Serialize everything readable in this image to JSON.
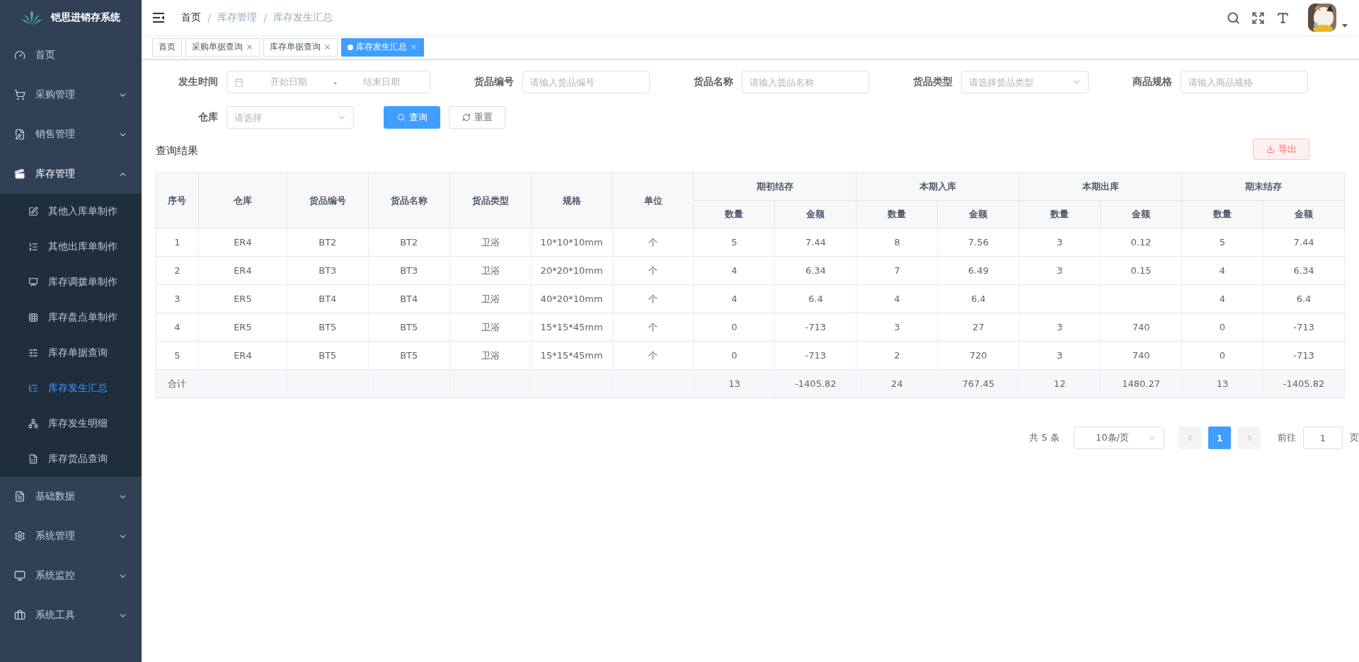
{
  "app": {
    "title": "铠思进销存系统"
  },
  "sidebar": {
    "items": [
      {
        "kind": "link",
        "label": "首页"
      },
      {
        "kind": "group",
        "label": "采购管理",
        "expanded": false
      },
      {
        "kind": "group",
        "label": "销售管理",
        "expanded": false
      },
      {
        "kind": "group",
        "label": "库存管理",
        "expanded": true,
        "children": [
          {
            "label": "其他入库单制作",
            "selected": false
          },
          {
            "label": "其他出库单制作",
            "selected": false
          },
          {
            "label": "库存调拨单制作",
            "selected": false
          },
          {
            "label": "库存盘点单制作",
            "selected": false
          },
          {
            "label": "库存单据查询",
            "selected": false
          },
          {
            "label": "库存发生汇总",
            "selected": true
          },
          {
            "label": "库存发生明细",
            "selected": false
          },
          {
            "label": "库存货品查询",
            "selected": false
          }
        ]
      },
      {
        "kind": "group",
        "label": "基础数据",
        "expanded": false
      },
      {
        "kind": "group",
        "label": "系统管理",
        "expanded": false
      },
      {
        "kind": "group",
        "label": "系统监控",
        "expanded": false
      },
      {
        "kind": "group",
        "label": "系统工具",
        "expanded": false
      }
    ]
  },
  "breadcrumb": {
    "items": [
      "首页",
      "库存管理",
      "库存发生汇总"
    ],
    "separator": "/"
  },
  "tags": [
    {
      "label": "首页",
      "selected": false,
      "closable": false
    },
    {
      "label": "采购单据查询",
      "selected": false,
      "closable": true
    },
    {
      "label": "库存单据查询",
      "selected": false,
      "closable": true
    },
    {
      "label": "库存发生汇总",
      "selected": true,
      "closable": true
    }
  ],
  "filters": [
    {
      "kind": "date-range",
      "label": "发生时间",
      "start_placeholder": "开始日期",
      "separator": "-",
      "end_placeholder": "结束日期"
    },
    {
      "kind": "input",
      "label": "货品编号",
      "placeholder": "请输入货品编号"
    },
    {
      "kind": "input",
      "label": "货品名称",
      "placeholder": "请输入货品名称"
    },
    {
      "kind": "select",
      "label": "货品类型",
      "placeholder": "请选择货品类型"
    },
    {
      "kind": "input",
      "label": "商品规格",
      "placeholder": "请输入商品规格"
    },
    {
      "kind": "select",
      "label": "仓库",
      "placeholder": "请选择"
    }
  ],
  "actions": {
    "search": "查询",
    "reset": "重置"
  },
  "results": {
    "title": "查询结果",
    "export": "导出"
  },
  "table": {
    "columns": [
      {
        "label": "序号"
      },
      {
        "label": "仓库"
      },
      {
        "label": "货品编号"
      },
      {
        "label": "货品名称"
      },
      {
        "label": "货品类型"
      },
      {
        "label": "规格"
      },
      {
        "label": "单位"
      },
      {
        "label": "期初结存",
        "colspan": 2,
        "children": [
          "数量",
          "金额"
        ]
      },
      {
        "label": "本期入库",
        "colspan": 2,
        "children": [
          "数量",
          "金额"
        ]
      },
      {
        "label": "本期出库",
        "colspan": 2,
        "children": [
          "数量",
          "金额"
        ]
      },
      {
        "label": "期末结存",
        "colspan": 2,
        "children": [
          "数量",
          "金额"
        ]
      }
    ],
    "rows": [
      [
        "1",
        "ER4",
        "BT2",
        "BT2",
        "卫浴",
        "10*10*10mm",
        "个",
        "5",
        "7.44",
        "8",
        "7.56",
        "3",
        "0.12",
        "5",
        "7.44"
      ],
      [
        "2",
        "ER4",
        "BT3",
        "BT3",
        "卫浴",
        "20*20*10mm",
        "个",
        "4",
        "6.34",
        "7",
        "6.49",
        "3",
        "0.15",
        "4",
        "6.34"
      ],
      [
        "3",
        "ER5",
        "BT4",
        "BT4",
        "卫浴",
        "40*20*10mm",
        "个",
        "4",
        "6.4",
        "4",
        "6.4",
        null,
        null,
        "4",
        "6.4"
      ],
      [
        "4",
        "ER5",
        "BT5",
        "BT5",
        "卫浴",
        "15*15*45mm",
        "个",
        "0",
        "-713",
        "3",
        "27",
        "3",
        "740",
        "0",
        "-713"
      ],
      [
        "5",
        "ER4",
        "BT5",
        "BT5",
        "卫浴",
        "15*15*45mm",
        "个",
        "0",
        "-713",
        "2",
        "720",
        "3",
        "740",
        "0",
        "-713"
      ]
    ],
    "summary": {
      "label": "合计",
      "values": [
        "13",
        "-1405.82",
        "24",
        "767.45",
        "12",
        "1480.27",
        "13",
        "-1405.82"
      ]
    }
  },
  "pagination": {
    "total": "共 5 条",
    "page_size": "10条/页",
    "prev_disabled": true,
    "next_disabled": true,
    "pages": [
      {
        "label": "1",
        "selected": true
      }
    ],
    "goto_label": "前往",
    "goto_value": "1",
    "goto_suffix": "页"
  }
}
